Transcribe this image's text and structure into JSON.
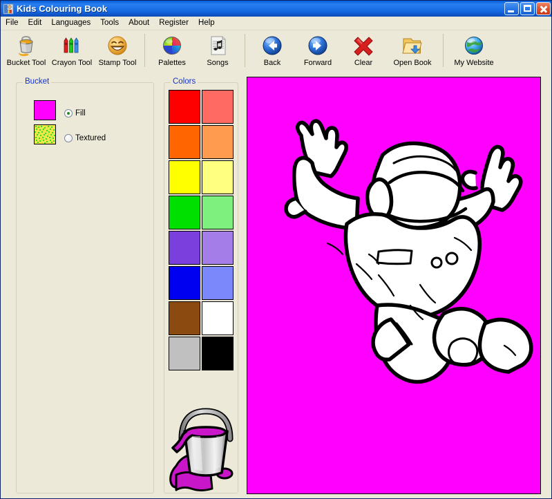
{
  "window": {
    "title": "Kids Colouring Book",
    "icon": "app-icon",
    "buttons": {
      "minimize": "minimize-button",
      "maximize": "maximize-button",
      "close": "close-button"
    }
  },
  "menubar": {
    "items": [
      {
        "label": "File"
      },
      {
        "label": "Edit"
      },
      {
        "label": "Languages"
      },
      {
        "label": "Tools"
      },
      {
        "label": "About"
      },
      {
        "label": "Register"
      },
      {
        "label": "Help"
      }
    ]
  },
  "toolbar": {
    "groups": [
      {
        "buttons": [
          {
            "label": "Bucket Tool",
            "icon": "paint-bucket-icon"
          },
          {
            "label": "Crayon Tool",
            "icon": "crayons-icon"
          },
          {
            "label": "Stamp Tool",
            "icon": "smiley-stamp-icon"
          }
        ]
      },
      {
        "buttons": [
          {
            "label": "Palettes",
            "icon": "color-wheel-icon"
          },
          {
            "label": "Songs",
            "icon": "music-sheet-icon"
          }
        ]
      },
      {
        "buttons": [
          {
            "label": "Back",
            "icon": "back-arrow-icon"
          },
          {
            "label": "Forward",
            "icon": "forward-arrow-icon"
          },
          {
            "label": "Clear",
            "icon": "red-x-icon"
          },
          {
            "label": "Open Book",
            "icon": "open-folder-icon"
          }
        ]
      },
      {
        "buttons": [
          {
            "label": "My Website",
            "icon": "globe-icon"
          }
        ]
      }
    ]
  },
  "bucket_panel": {
    "title": "Bucket",
    "fill_swatch_color": "#ff00ff",
    "textured_swatch": "yellow-green-noise",
    "options": [
      {
        "label": "Fill",
        "selected": true
      },
      {
        "label": "Textured",
        "selected": false
      }
    ],
    "preview_icon": "paint-bucket-pouring-magenta"
  },
  "colors_panel": {
    "title": "Colors",
    "swatches": [
      {
        "name": "red",
        "hex": "#ff0000"
      },
      {
        "name": "salmon",
        "hex": "#ff6b63"
      },
      {
        "name": "orange",
        "hex": "#ff6600"
      },
      {
        "name": "light-orange",
        "hex": "#ff9b4f"
      },
      {
        "name": "yellow",
        "hex": "#ffff00"
      },
      {
        "name": "light-yellow",
        "hex": "#ffff80"
      },
      {
        "name": "green",
        "hex": "#00e000"
      },
      {
        "name": "light-green",
        "hex": "#7df07d"
      },
      {
        "name": "purple",
        "hex": "#7a3fdc"
      },
      {
        "name": "light-purple",
        "hex": "#a47de8"
      },
      {
        "name": "blue",
        "hex": "#0000f0"
      },
      {
        "name": "light-blue",
        "hex": "#7b88fb"
      },
      {
        "name": "brown",
        "hex": "#8a4a10"
      },
      {
        "name": "white",
        "hex": "#ffffff"
      },
      {
        "name": "gray",
        "hex": "#c0c0c0"
      },
      {
        "name": "black",
        "hex": "#000000"
      }
    ]
  },
  "canvas": {
    "background_color": "#ff00ff",
    "artwork": "astronaut-line-drawing",
    "line_color": "#000000",
    "fill_color": "#ffffff"
  }
}
